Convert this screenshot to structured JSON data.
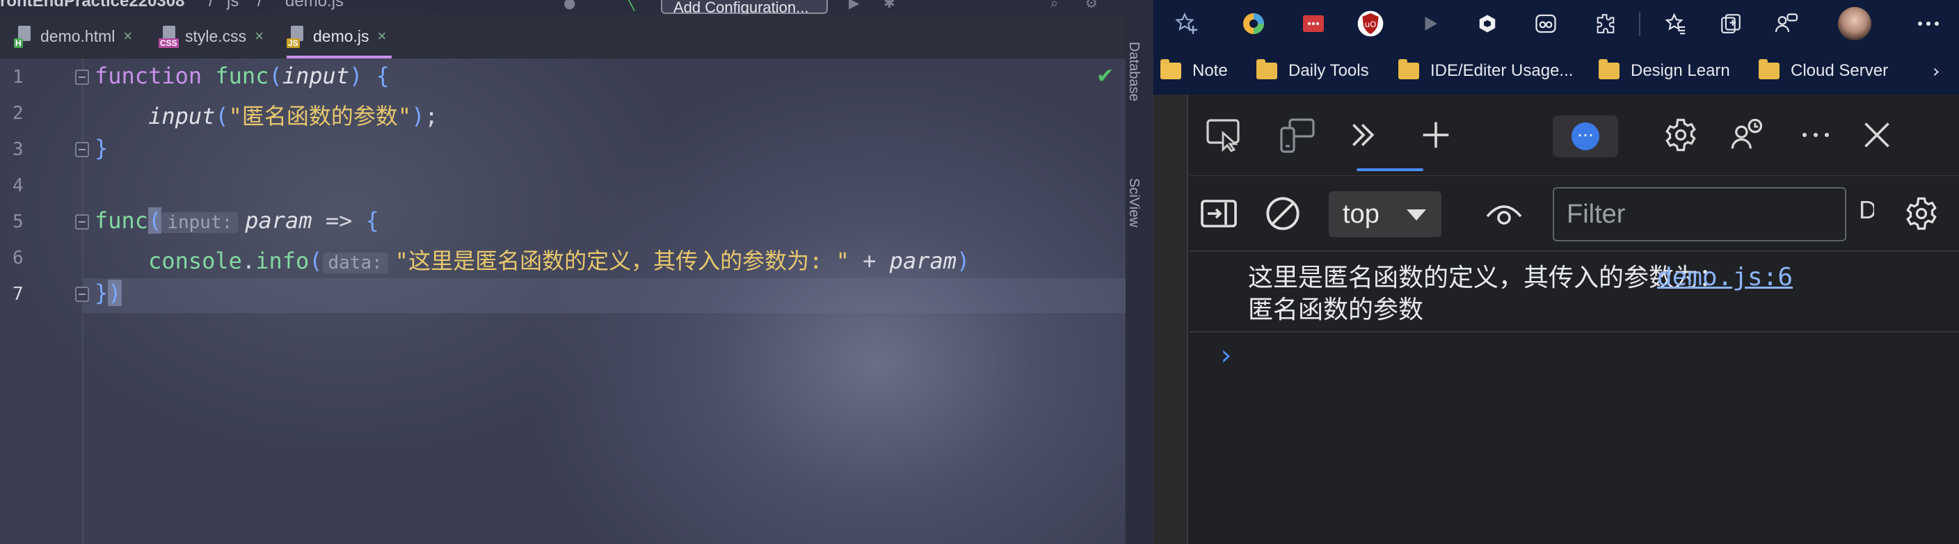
{
  "ide": {
    "project_name": "rontEndPractice220308",
    "breadcrumb": [
      "js",
      "demo.js"
    ],
    "run_config": "Add Configuration...",
    "tabs": [
      {
        "name": "demo.html",
        "type": "H",
        "color": "#4aa35a"
      },
      {
        "name": "style.css",
        "type": "CSS",
        "color": "#b44aa0"
      },
      {
        "name": "demo.js",
        "type": "JS",
        "color": "#c9a227",
        "active": true
      }
    ],
    "line_numbers": [
      "1",
      "2",
      "3",
      "4",
      "5",
      "6",
      "7"
    ],
    "current_line": 7,
    "code": {
      "l1_kw": "function",
      "l1_name": "func",
      "l1_param": "input",
      "l2_call": "input",
      "l2_str": "\"匿名函数的参数\"",
      "l5_call": "func",
      "l5_hint": "input:",
      "l5_param": "param",
      "l5_arrow": "=>",
      "l6_obj": "console",
      "l6_method": "info",
      "l6_hint": "data:",
      "l6_str": "\"这里是匿名函数的定义，其传入的参数为: \"",
      "l6_plus": "+",
      "l6_param": "param"
    },
    "right_rail": [
      "Database",
      "SciView"
    ]
  },
  "browser": {
    "extension_icons": [
      "favorites-add-icon",
      "color-wheel-icon",
      "ext-red-icon",
      "ublock-icon",
      "play-icon",
      "hexagon-icon",
      "glasses-icon",
      "puzzle-icon",
      "collections-star-icon",
      "collections-icon",
      "profile-switch-icon",
      "avatar",
      "more-icon"
    ],
    "bookmarks": [
      "Note",
      "Daily Tools",
      "IDE/Editer Usage...",
      "Design Learn",
      "Cloud Server"
    ],
    "devtools": {
      "context": "top",
      "filter_placeholder": "Filter",
      "clipped_label": "D",
      "console_message_line1": "这里是匿名函数的定义，其传入的参数为：",
      "console_message_line2": "匿名函数的参数",
      "console_source": "demo.js:6",
      "accent": "#4c8dff"
    }
  }
}
